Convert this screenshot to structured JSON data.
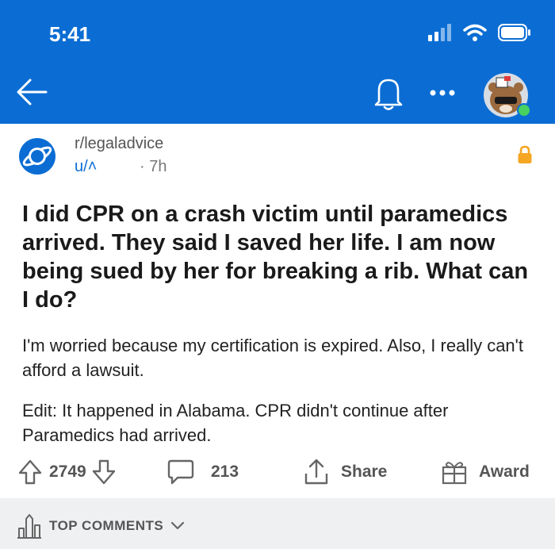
{
  "status_bar": {
    "time": "5:41"
  },
  "post": {
    "subreddit": "r/legaladvice",
    "author": "u/˄",
    "age": "· 7h",
    "title": "I did CPR on a crash victim until paramedics arrived. They said I saved her life. I am now being sued by her for breaking a rib. What can I do?",
    "paragraphs": [
      "I'm worried because my certification is expired. Also, I really can't afford a lawsuit.",
      "Edit: It happened in Alabama. CPR didn't continue after Paramedics had arrived."
    ]
  },
  "actions": {
    "upvotes": "2749",
    "comments": "213",
    "share": "Share",
    "award": "Award"
  },
  "comments_section": {
    "label": "TOP COMMENTS"
  },
  "colors": {
    "header": "#0b6dd4",
    "accent": "#0b6dd4",
    "lock": "#f5a623"
  }
}
